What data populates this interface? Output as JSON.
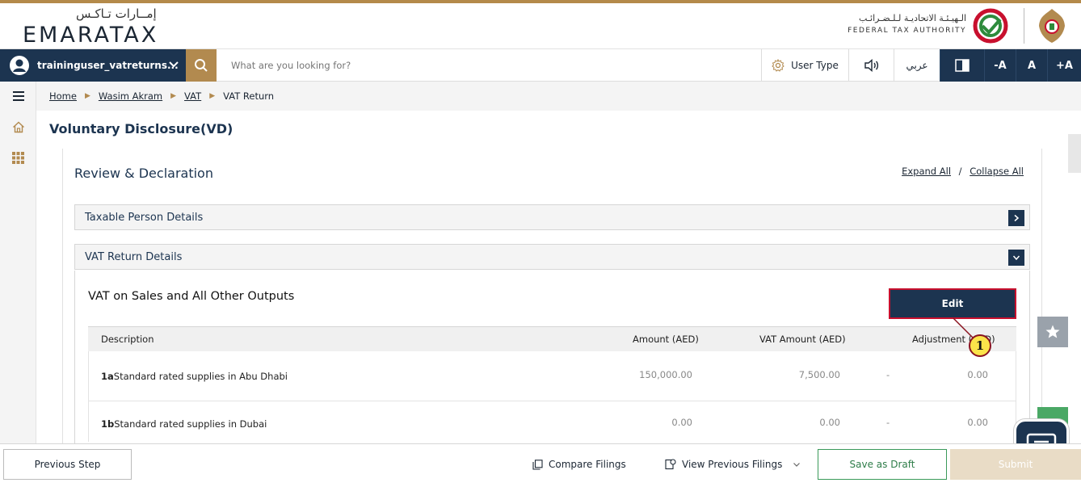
{
  "header": {
    "logo_ar": "إمــارات تـاكـس",
    "logo_en": "EMARATAX",
    "fta_ar": "الـهيـئـة الاتحاديـة لـلـضـرائـب",
    "fta_en": "FEDERAL TAX AUTHORITY"
  },
  "navbar": {
    "username": "traininguser_vatreturns...",
    "search_placeholder": "What are you looking for?",
    "user_type": "User Type",
    "language": "عربي",
    "font_decrease": "-A",
    "font_normal": "A",
    "font_increase": "+A"
  },
  "breadcrumb": {
    "items": [
      "Home",
      "Wasim Akram",
      "VAT"
    ],
    "current": "VAT Return"
  },
  "page": {
    "title": "Voluntary Disclosure(VD)",
    "section_title": "Review & Declaration",
    "expand_all": "Expand All",
    "separator": "/",
    "collapse_all": "Collapse All"
  },
  "accordions": {
    "taxable_person": "Taxable Person Details",
    "vat_return": "VAT Return Details"
  },
  "vat_sales": {
    "title": "VAT on Sales and All Other Outputs",
    "edit_label": "Edit",
    "columns": {
      "description": "Description",
      "amount": "Amount (AED)",
      "vat_amount": "VAT Amount (AED)",
      "adjustment": "Adjustment (AED)"
    },
    "rows": [
      {
        "code": "1a",
        "description": "Standard rated supplies in Abu Dhabi",
        "amount": "150,000.00",
        "vat_amount": "7,500.00",
        "dash": "-",
        "adjustment": "0.00"
      },
      {
        "code": "1b",
        "description": "Standard rated supplies in Dubai",
        "amount": "0.00",
        "vat_amount": "0.00",
        "dash": "-",
        "adjustment": "0.00"
      }
    ]
  },
  "callout": {
    "number": "1"
  },
  "footer": {
    "previous_step": "Previous Step",
    "compare_filings": "Compare Filings",
    "view_previous_filings": "View Previous Filings",
    "save_as_draft": "Save as Draft",
    "submit": "Submit"
  },
  "colors": {
    "navy": "#1c3450",
    "gold": "#b28a4f",
    "callout_yellow": "#fbe44a",
    "highlight_red": "#c8102e",
    "green": "#3a9a5a"
  }
}
